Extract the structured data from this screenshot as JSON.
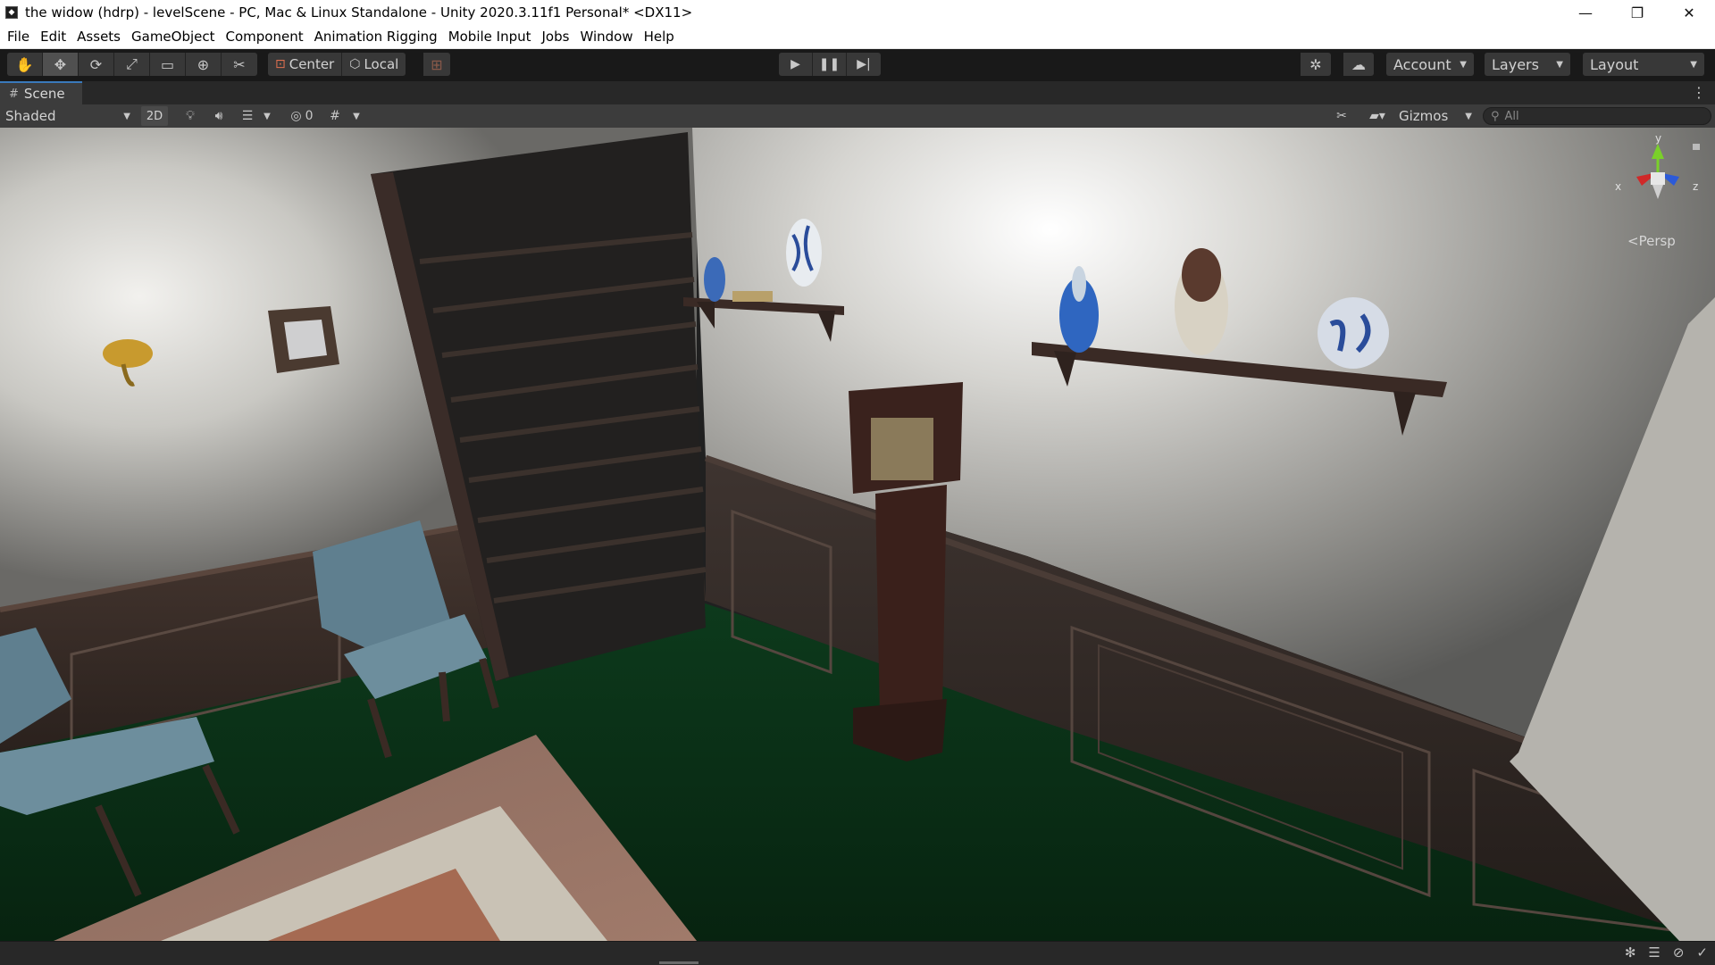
{
  "window": {
    "title": "the widow (hdrp) - levelScene - PC, Mac & Linux Standalone - Unity 2020.3.11f1 Personal* <DX11>",
    "minimize_icon": "minimize-icon",
    "maximize_icon": "restore-icon",
    "close_icon": "close-icon"
  },
  "menu": {
    "items": [
      "File",
      "Edit",
      "Assets",
      "GameObject",
      "Component",
      "Animation Rigging",
      "Mobile Input",
      "Jobs",
      "Window",
      "Help"
    ]
  },
  "toolbar": {
    "tools": [
      "hand-tool-icon",
      "move-tool-icon",
      "rotate-tool-icon",
      "scale-tool-icon",
      "rect-tool-icon",
      "transform-tool-icon",
      "custom-tool-icon"
    ],
    "pivot_mode": "Center",
    "pivot_rotation": "Local",
    "grid_snap_icon": "grid-snap-icon",
    "play_icons": [
      "play-icon",
      "pause-icon",
      "step-icon"
    ],
    "account_label": "Account",
    "layers_label": "Layers",
    "layout_label": "Layout"
  },
  "scene_tab": {
    "label": "Scene"
  },
  "scene_toolbar": {
    "draw_mode": "Shaded",
    "mode_2d": "2D",
    "hidden_count": "0",
    "gizmos_label": "Gizmos",
    "search_placeholder": "All"
  },
  "gizmo": {
    "projection": "Persp",
    "axis_y": "y",
    "axis_x": "x",
    "axis_z": "z"
  },
  "colors": {
    "accent": "#3a79bb",
    "axis_x": "#d02828",
    "axis_y": "#7ad02a",
    "axis_z": "#2c5ad8"
  }
}
